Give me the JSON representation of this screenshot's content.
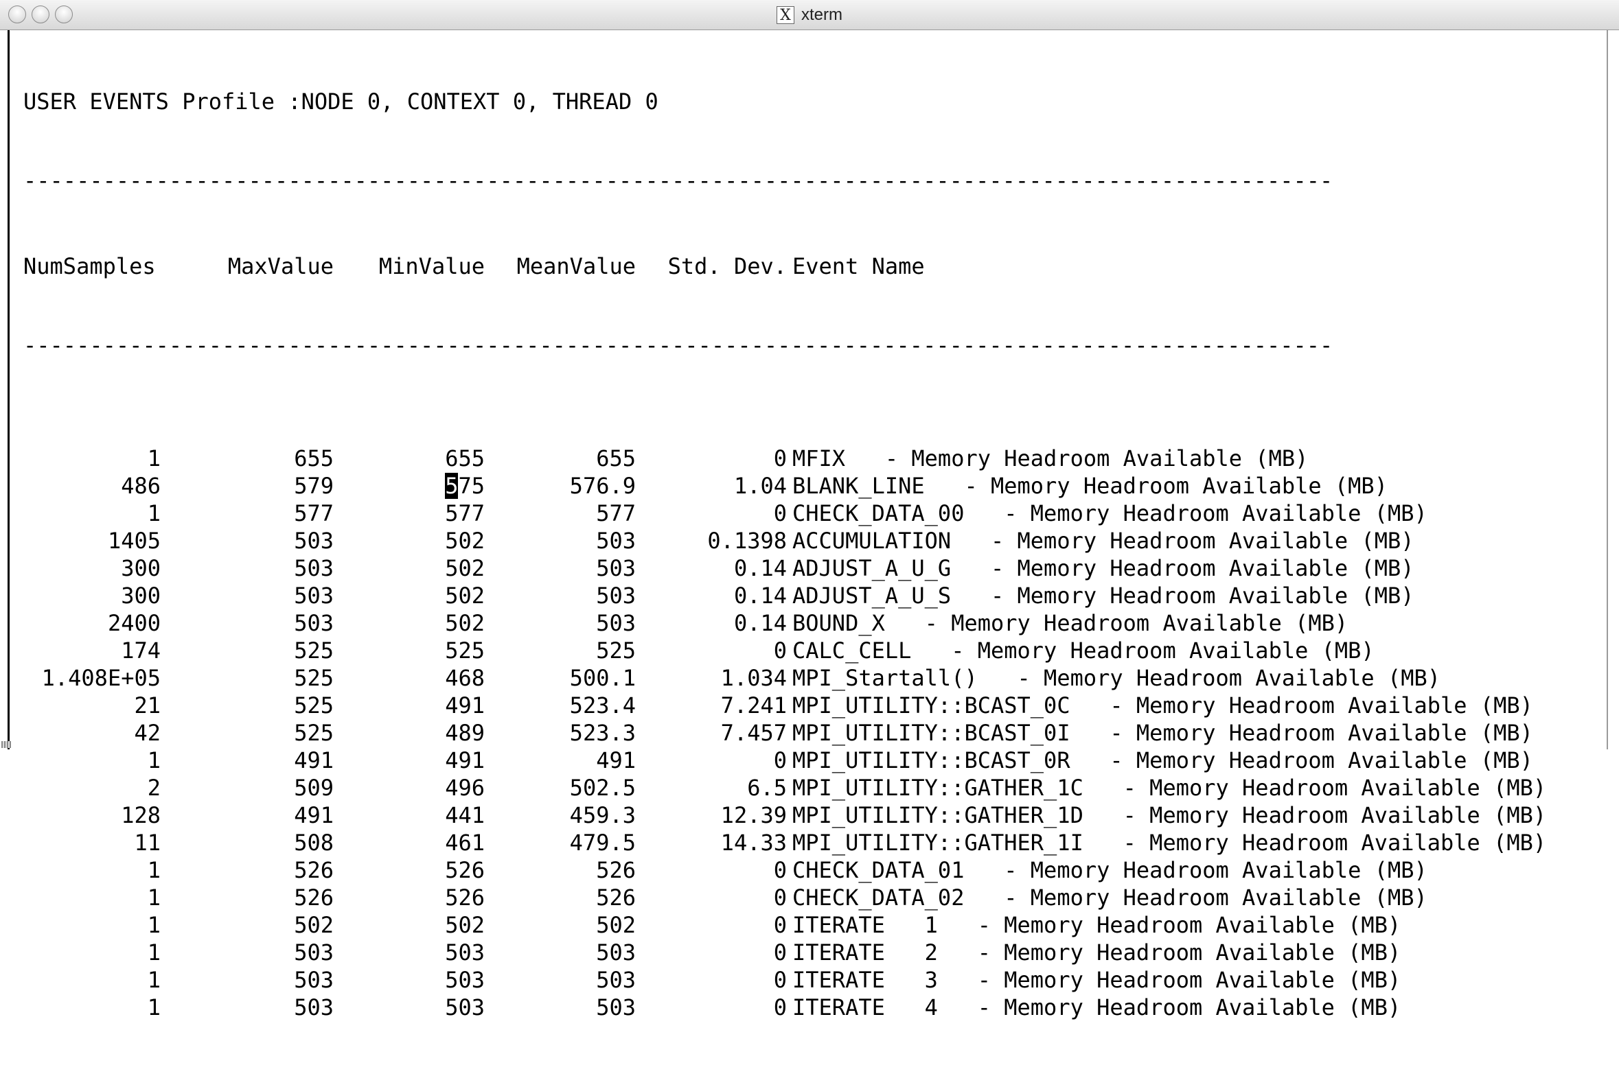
{
  "window": {
    "title": "xterm",
    "title_icon": "x11-icon",
    "buttons": [
      "close-button",
      "minimize-button",
      "zoom-button"
    ]
  },
  "terminal": {
    "heading": "USER EVENTS Profile :NODE 0, CONTEXT 0, THREAD 0",
    "separator": "---------------------------------------------------------------------------------------------------",
    "columns": [
      "NumSamples",
      "MaxValue",
      "MinValue",
      "MeanValue",
      "Std. Dev.",
      "Event Name"
    ],
    "rows": [
      {
        "num_samples": "1",
        "max": "655",
        "min": "655",
        "mean": "655",
        "std": "0",
        "name": "MFIX   - Memory Headroom Available (MB)"
      },
      {
        "num_samples": "486",
        "max": "579",
        "min_cursor": "5",
        "min_rest": "75",
        "mean": "576.9",
        "std": "1.04",
        "name": "BLANK_LINE   - Memory Headroom Available (MB)"
      },
      {
        "num_samples": "1",
        "max": "577",
        "min": "577",
        "mean": "577",
        "std": "0",
        "name": "CHECK_DATA_00   - Memory Headroom Available (MB)"
      },
      {
        "num_samples": "1405",
        "max": "503",
        "min": "502",
        "mean": "503",
        "std": "0.1398",
        "name": "ACCUMULATION   - Memory Headroom Available (MB)"
      },
      {
        "num_samples": "300",
        "max": "503",
        "min": "502",
        "mean": "503",
        "std": "0.14",
        "name": "ADJUST_A_U_G   - Memory Headroom Available (MB)"
      },
      {
        "num_samples": "300",
        "max": "503",
        "min": "502",
        "mean": "503",
        "std": "0.14",
        "name": "ADJUST_A_U_S   - Memory Headroom Available (MB)"
      },
      {
        "num_samples": "2400",
        "max": "503",
        "min": "502",
        "mean": "503",
        "std": "0.14",
        "name": "BOUND_X   - Memory Headroom Available (MB)"
      },
      {
        "num_samples": "174",
        "max": "525",
        "min": "525",
        "mean": "525",
        "std": "0",
        "name": "CALC_CELL   - Memory Headroom Available (MB)"
      },
      {
        "num_samples": "1.408E+05",
        "max": "525",
        "min": "468",
        "mean": "500.1",
        "std": "1.034",
        "name": "MPI_Startall()   - Memory Headroom Available (MB)"
      },
      {
        "num_samples": "21",
        "max": "525",
        "min": "491",
        "mean": "523.4",
        "std": "7.241",
        "name": "MPI_UTILITY::BCAST_0C   - Memory Headroom Available (MB)"
      },
      {
        "num_samples": "42",
        "max": "525",
        "min": "489",
        "mean": "523.3",
        "std": "7.457",
        "name": "MPI_UTILITY::BCAST_0I   - Memory Headroom Available (MB)"
      },
      {
        "num_samples": "1",
        "max": "491",
        "min": "491",
        "mean": "491",
        "std": "0",
        "name": "MPI_UTILITY::BCAST_0R   - Memory Headroom Available (MB)"
      },
      {
        "num_samples": "2",
        "max": "509",
        "min": "496",
        "mean": "502.5",
        "std": "6.5",
        "name": "MPI_UTILITY::GATHER_1C   - Memory Headroom Available (MB)"
      },
      {
        "num_samples": "128",
        "max": "491",
        "min": "441",
        "mean": "459.3",
        "std": "12.39",
        "name": "MPI_UTILITY::GATHER_1D   - Memory Headroom Available (MB)"
      },
      {
        "num_samples": "11",
        "max": "508",
        "min": "461",
        "mean": "479.5",
        "std": "14.33",
        "name": "MPI_UTILITY::GATHER_1I   - Memory Headroom Available (MB)"
      },
      {
        "num_samples": "1",
        "max": "526",
        "min": "526",
        "mean": "526",
        "std": "0",
        "name": "CHECK_DATA_01   - Memory Headroom Available (MB)"
      },
      {
        "num_samples": "1",
        "max": "526",
        "min": "526",
        "mean": "526",
        "std": "0",
        "name": "CHECK_DATA_02   - Memory Headroom Available (MB)"
      },
      {
        "num_samples": "1",
        "max": "502",
        "min": "502",
        "mean": "502",
        "std": "0",
        "name": "ITERATE   1   - Memory Headroom Available (MB)"
      },
      {
        "num_samples": "1",
        "max": "503",
        "min": "503",
        "mean": "503",
        "std": "0",
        "name": "ITERATE   2   - Memory Headroom Available (MB)"
      },
      {
        "num_samples": "1",
        "max": "503",
        "min": "503",
        "mean": "503",
        "std": "0",
        "name": "ITERATE   3   - Memory Headroom Available (MB)"
      },
      {
        "num_samples": "1",
        "max": "503",
        "min": "503",
        "mean": "503",
        "std": "0",
        "name": "ITERATE   4   - Memory Headroom Available (MB)"
      }
    ]
  }
}
